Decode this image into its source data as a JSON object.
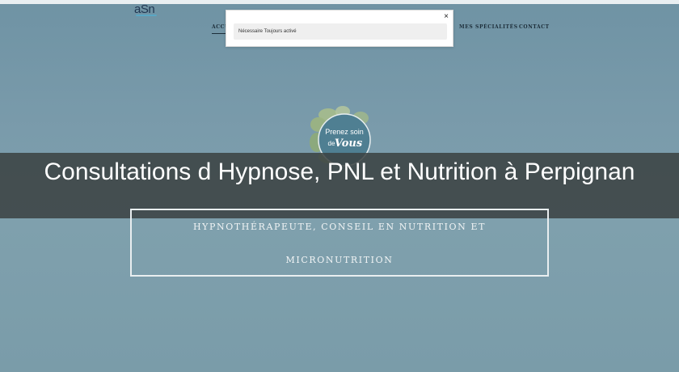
{
  "site": {
    "logo_text": "aSn"
  },
  "nav": {
    "items": [
      {
        "label": "ACCUEIL",
        "active": true
      },
      {
        "label": "MES SPÉCIALITÉS",
        "active": false
      },
      {
        "label": "CONTACT",
        "active": false
      }
    ]
  },
  "cookie_modal": {
    "close_symbol": "×",
    "row_label": "Nécessaire Toujours activé"
  },
  "hero": {
    "badge_line1": "Prenez soin",
    "badge_line2a": "de",
    "badge_line2b": "Vous",
    "title": "Consultations d Hypnose, PNL et Nutrition à Perpignan",
    "tagline_line1": "HYPNOTHÉRAPEUTE, CONSEIL EN NUTRITION ET",
    "tagline_line2": "MICRONUTRITION"
  }
}
